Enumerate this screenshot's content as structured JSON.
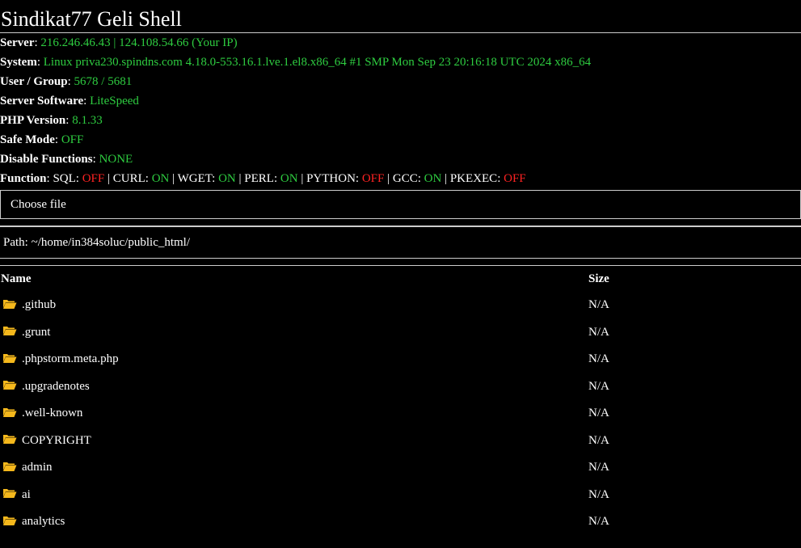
{
  "title": "Sindikat77 Geli Shell",
  "info": {
    "server_label": "Server",
    "server_value": "216.246.46.43 | 124.108.54.66 (Your IP)",
    "system_label": "System",
    "system_value": "Linux priva230.spindns.com 4.18.0-553.16.1.lve.1.el8.x86_64 #1 SMP Mon Sep 23 20:16:18 UTC 2024 x86_64",
    "user_label": "User / Group",
    "user_value": "5678 / 5681",
    "software_label": "Server Software",
    "software_value": "LiteSpeed",
    "php_label": "PHP Version",
    "php_value": "8.1.33",
    "safe_label": "Safe Mode",
    "safe_value": "OFF",
    "disable_label": "Disable Functions",
    "disable_value": "NONE",
    "function_label": "Function",
    "functions": [
      {
        "name": "SQL",
        "value": "OFF"
      },
      {
        "name": "CURL",
        "value": "ON"
      },
      {
        "name": "WGET",
        "value": "ON"
      },
      {
        "name": "PERL",
        "value": "ON"
      },
      {
        "name": "PYTHON",
        "value": "OFF"
      },
      {
        "name": "GCC",
        "value": "ON"
      },
      {
        "name": "PKEXEC",
        "value": "OFF"
      }
    ]
  },
  "upload": {
    "choose_label": "Choose file"
  },
  "path": {
    "text": "Path: ~/home/in384soluc/public_html/"
  },
  "table": {
    "col_name": "Name",
    "col_size": "Size",
    "rows": [
      {
        "name": ".github",
        "size": "N/A"
      },
      {
        "name": ".grunt",
        "size": "N/A"
      },
      {
        "name": ".phpstorm.meta.php",
        "size": "N/A"
      },
      {
        "name": ".upgradenotes",
        "size": "N/A"
      },
      {
        "name": ".well-known",
        "size": "N/A"
      },
      {
        "name": "COPYRIGHT",
        "size": "N/A"
      },
      {
        "name": "admin",
        "size": "N/A"
      },
      {
        "name": "ai",
        "size": "N/A"
      },
      {
        "name": "analytics",
        "size": "N/A"
      }
    ]
  },
  "colors": {
    "background": "#000000",
    "on": "#2ecc40",
    "off": "#ff2222",
    "folder": "#f5b81c"
  }
}
